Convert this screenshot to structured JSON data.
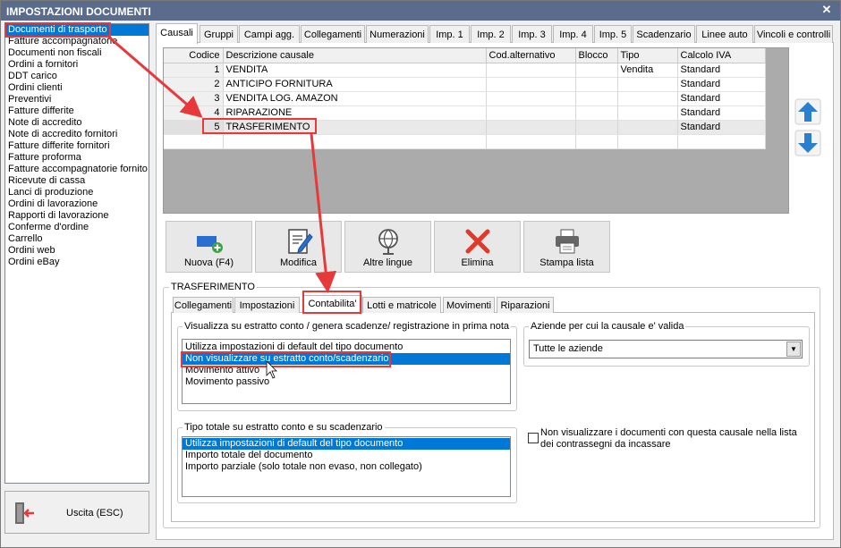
{
  "window": {
    "title": "IMPOSTAZIONI DOCUMENTI",
    "close_glyph": "✕"
  },
  "left_list": [
    "Documenti di trasporto",
    "Fatture accompagnatorie",
    "Documenti non fiscali",
    "Ordini a fornitori",
    "DDT carico",
    "Ordini clienti",
    "Preventivi",
    "Fatture differite",
    "Note di accredito",
    "Note di accredito fornitori",
    "Fatture differite fornitori",
    "Fatture proforma",
    "Fatture accompagnatorie fornito",
    "Ricevute di cassa",
    "Lanci di produzione",
    "Ordini di lavorazione",
    "Rapporti di lavorazione",
    "Conferme d'ordine",
    "Carrello",
    "Ordini web",
    "Ordini eBay"
  ],
  "exit_button": {
    "label": "Uscita (ESC)",
    "icon": "exit-door-icon"
  },
  "top_tabs": [
    "Causali",
    "Gruppi",
    "Campi agg.",
    "Collegamenti",
    "Numerazioni",
    "Imp. 1",
    "Imp. 2",
    "Imp. 3",
    "Imp. 4",
    "Imp. 5",
    "Scadenzario",
    "Linee auto",
    "Vincoli e controlli"
  ],
  "grid": {
    "columns": [
      "Codice",
      "Descrizione causale",
      "Cod.alternativo",
      "Blocco",
      "Tipo",
      "Calcolo IVA"
    ],
    "rows": [
      {
        "codice": "1",
        "descrizione": "VENDITA",
        "cod_alt": "",
        "blocco": "",
        "tipo": "Vendita",
        "calcolo_iva": "Standard"
      },
      {
        "codice": "2",
        "descrizione": "ANTICIPO FORNITURA",
        "cod_alt": "",
        "blocco": "",
        "tipo": "",
        "calcolo_iva": "Standard"
      },
      {
        "codice": "3",
        "descrizione": "VENDITA LOG. AMAZON",
        "cod_alt": "",
        "blocco": "",
        "tipo": "",
        "calcolo_iva": "Standard"
      },
      {
        "codice": "4",
        "descrizione": "RIPARAZIONE",
        "cod_alt": "",
        "blocco": "",
        "tipo": "",
        "calcolo_iva": "Standard"
      },
      {
        "codice": "5",
        "descrizione": "TRASFERIMENTO",
        "cod_alt": "",
        "blocco": "",
        "tipo": "",
        "calcolo_iva": "Standard"
      }
    ]
  },
  "side_arrows": {
    "up": "arrow-up-icon",
    "down": "arrow-down-icon"
  },
  "actions": {
    "nuova": "Nuova (F4)",
    "modifica": "Modifica",
    "altre_lingue": "Altre lingue",
    "elimina": "Elimina",
    "stampa": "Stampa lista"
  },
  "group_title": "TRASFERIMENTO",
  "inner_tabs": [
    "Collegamenti",
    "Impostazioni",
    "Contabilita'",
    "Lotti e matricole",
    "Movimenti",
    "Riparazioni"
  ],
  "estratto": {
    "title": "Visualizza su estratto conto / genera scadenze/ registrazione  in prima nota",
    "options": [
      "Utilizza impostazioni di default del tipo documento",
      "Non visualizzare su estratto conto/scadenzario",
      "Movimento attivo",
      "Movimento passivo"
    ],
    "selected_index": 1
  },
  "aziende": {
    "title": "Aziende per cui la causale e' valida",
    "value": "Tutte le aziende"
  },
  "tipo_totale": {
    "title": "Tipo totale su estratto conto e su scadenzario",
    "options": [
      "Utilizza impostazioni di default del tipo documento",
      "Importo totale del documento",
      "Importo parziale (solo totale non evaso, non collegato)"
    ],
    "selected_index": 0
  },
  "checkbox": {
    "label": "Non visualizzare i documenti con questa causale nella lista dei contrassegni da incassare",
    "checked": false
  },
  "colors": {
    "selection": "#0078d7",
    "annotation": "#e8393a",
    "titlebar": "#5a6b8c"
  }
}
